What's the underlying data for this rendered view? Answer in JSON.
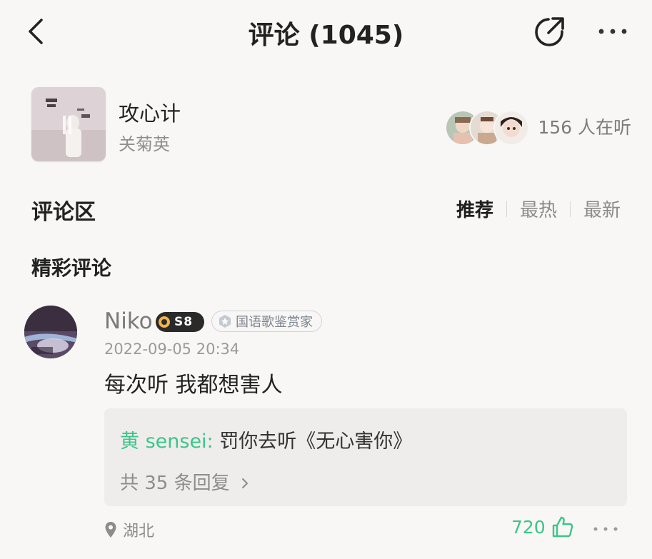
{
  "header": {
    "title": "评论 (1045)",
    "back_icon": "chevron-left-icon",
    "share_icon": "share-icon",
    "more_icon": "more-horizontal-icon"
  },
  "song": {
    "title": "攻心计",
    "artist": "关菊英",
    "listeners_text": "156 人在听"
  },
  "comments_section": {
    "title": "评论区",
    "sort_options": [
      "推荐",
      "最热",
      "最新"
    ],
    "active_sort": "推荐",
    "featured_label": "精彩评论"
  },
  "comment": {
    "username": "Niko",
    "level": "S8",
    "title_badge": "国语歌鉴赏家",
    "timestamp": "2022-09-05 20:34",
    "text": "每次听 我都想害人",
    "reply": {
      "user": "黄 sensei:",
      "text": " 罚你去听《无心害你》",
      "count_text": "共 35 条回复"
    },
    "location": "湖北",
    "likes": "720"
  },
  "colors": {
    "background": "#f8f7f5",
    "accent_green": "#3cc58a",
    "reply_box": "#eeedeb",
    "level_badge_ring": "#f3b34a"
  }
}
